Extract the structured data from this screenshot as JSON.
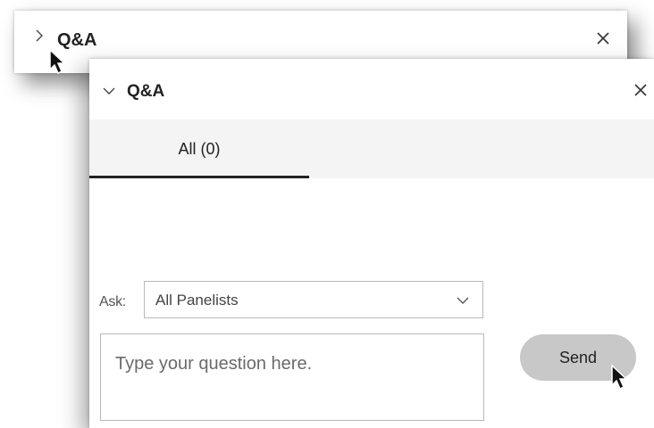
{
  "collapsed_panel": {
    "title": "Q&A",
    "expand_icon": "chevron-right-icon",
    "close_icon": "close-icon"
  },
  "panel": {
    "title": "Q&A",
    "collapse_icon": "chevron-down-icon",
    "close_icon": "close-icon",
    "tabs": [
      {
        "label": "All (0)",
        "active": true
      }
    ],
    "ask": {
      "label": "Ask:",
      "selected": "All Panelists",
      "dropdown_icon": "chevron-down-icon"
    },
    "question": {
      "placeholder": "Type your question here.",
      "value": ""
    },
    "send_label": "Send"
  },
  "colors": {
    "tabbar_bg": "#f4f4f4",
    "send_button_bg": "#c8c8c8",
    "text": "#222222",
    "border": "#b8b8b8"
  }
}
